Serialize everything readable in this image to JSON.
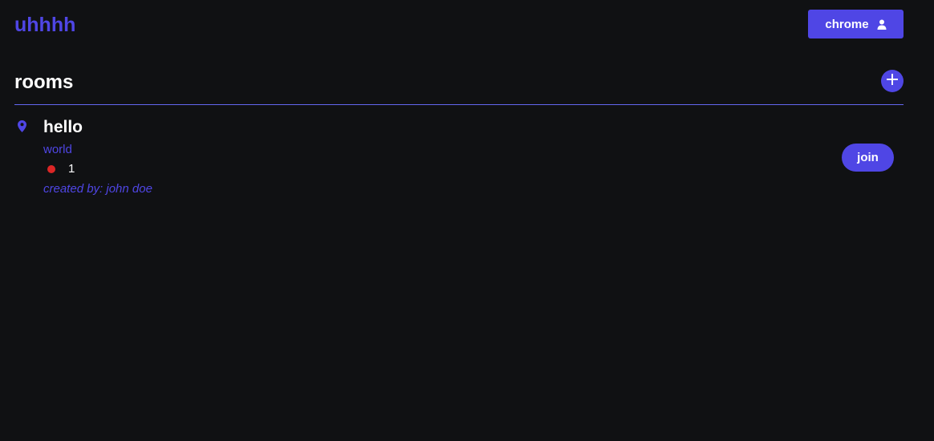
{
  "header": {
    "logo": "uhhhh",
    "user_button_label": "chrome",
    "user_icon": "user-icon"
  },
  "rooms_section": {
    "title": "rooms",
    "add_icon": "plus-icon"
  },
  "rooms": [
    {
      "name": "hello",
      "description": "world",
      "member_count": "1",
      "status_color": "#dc2626",
      "created_by": "created by: john doe",
      "join_label": "join",
      "icon": "location-pin-icon"
    }
  ],
  "colors": {
    "accent": "#4f46e5",
    "background": "#101113",
    "divider": "#6366f1",
    "status_offline": "#dc2626"
  }
}
